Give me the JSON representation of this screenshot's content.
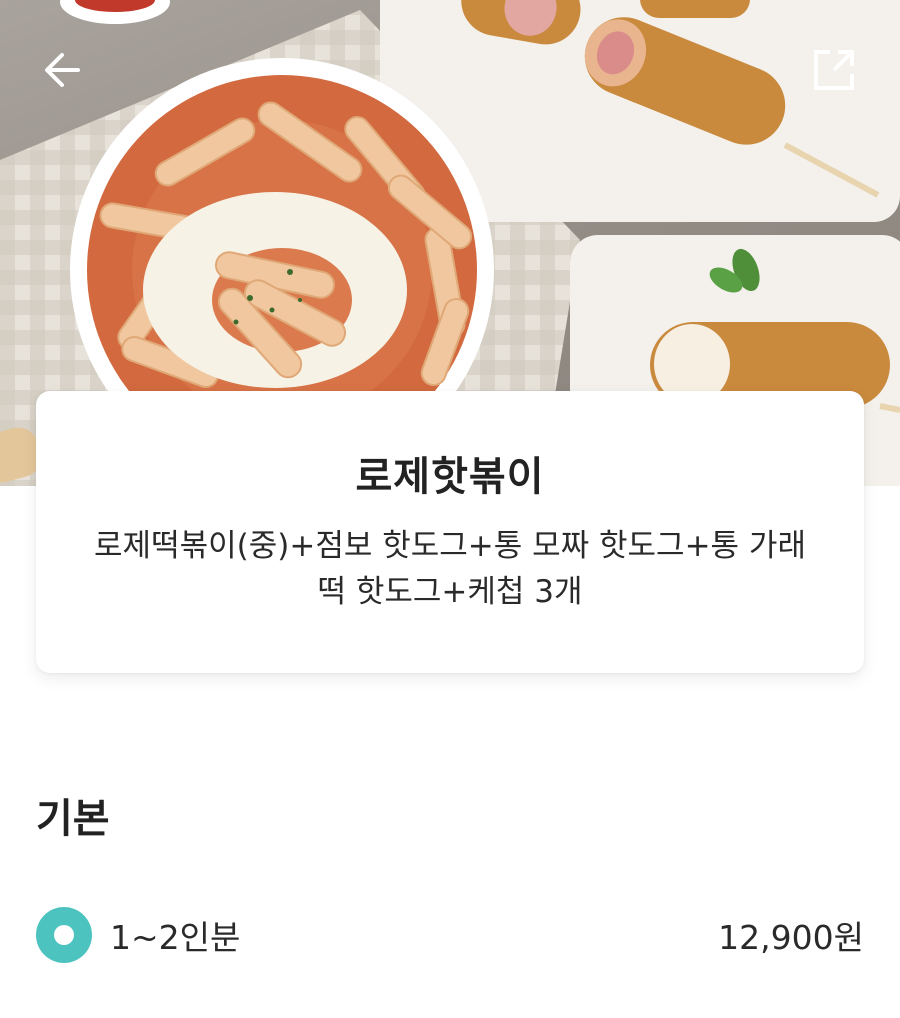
{
  "header": {
    "back_icon": "arrow-left-icon",
    "share_icon": "share-external-icon"
  },
  "hero": {
    "image_subject": "food-photo-rose-tteokbokki-and-hotdogs"
  },
  "menu": {
    "title": "로제핫볶이",
    "description": "로제떡볶이(중)+점보 핫도그+통 모짜 핫도그+통 가래떡 핫도그+케첩 3개"
  },
  "options": {
    "section_title": "기본",
    "items": [
      {
        "label": "1~2인분",
        "price": "12,900원",
        "selected": true
      }
    ]
  },
  "colors": {
    "accent": "#4cc3bf",
    "text": "#222222",
    "background": "#ffffff"
  }
}
